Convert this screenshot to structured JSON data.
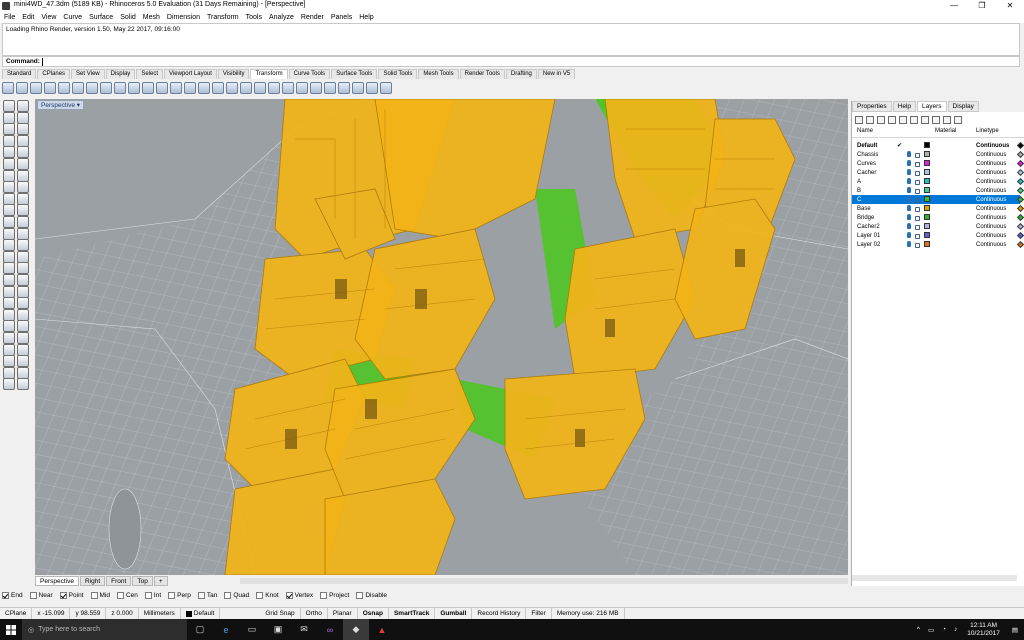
{
  "window": {
    "title": "mini4WD_47.3dm (5189 KB) - Rhinoceros 5.0 Evaluation (31 Days Remaining) - [Perspective]",
    "minimize": "—",
    "restore": "❐",
    "close": "✕"
  },
  "menu": [
    "File",
    "Edit",
    "View",
    "Curve",
    "Surface",
    "Solid",
    "Mesh",
    "Dimension",
    "Transform",
    "Tools",
    "Analyze",
    "Render",
    "Panels",
    "Help"
  ],
  "command_history": "Loading Rhino Render, version 1.50, May 22 2017, 09:16:00",
  "command_prompt": "Command:",
  "toolbar_tabs": [
    "Standard",
    "CPlanes",
    "Set View",
    "Display",
    "Select",
    "Viewport Layout",
    "Visibility",
    "Transform",
    "Curve Tools",
    "Surface Tools",
    "Solid Tools",
    "Mesh Tools",
    "Render Tools",
    "Drafting",
    "New in V5"
  ],
  "active_toolbar_tab": "Transform",
  "viewport": {
    "label": "Perspective",
    "dropdown": "▾"
  },
  "view_tabs": [
    "Perspective",
    "Right",
    "Front",
    "Top"
  ],
  "view_tab_add": "+",
  "osnaps": [
    {
      "label": "End",
      "on": true
    },
    {
      "label": "Near",
      "on": false
    },
    {
      "label": "Point",
      "on": true
    },
    {
      "label": "Mid",
      "on": false
    },
    {
      "label": "Cen",
      "on": false
    },
    {
      "label": "Int",
      "on": false
    },
    {
      "label": "Perp",
      "on": false
    },
    {
      "label": "Tan",
      "on": false
    },
    {
      "label": "Quad",
      "on": false
    },
    {
      "label": "Knot",
      "on": false
    },
    {
      "label": "Vertex",
      "on": true
    },
    {
      "label": "Project",
      "on": false
    },
    {
      "label": "Disable",
      "on": false
    }
  ],
  "status": {
    "cplane": "CPlane",
    "x": "x -15.099",
    "y": "y 98.559",
    "z": "z 0.000",
    "units": "Millimeters",
    "layer": "Default",
    "grid_snap": "Grid Snap",
    "ortho": "Ortho",
    "planar": "Planar",
    "osnap": "Osnap",
    "smarttrack": "SmartTrack",
    "gumball": "Gumball",
    "record_history": "Record History",
    "filter": "Filter",
    "memory": "Memory use: 216 MB"
  },
  "panel": {
    "tabs": [
      "Properties",
      "Help",
      "Layers",
      "Display"
    ],
    "active_tab": "Layers",
    "columns": {
      "name": "Name",
      "material": "Material",
      "linetype": "Linetype"
    },
    "layers": [
      {
        "name": "Default",
        "linetype": "Continuous",
        "color": "#000000",
        "current": true,
        "bold": true
      },
      {
        "name": "Chassis",
        "linetype": "Continuous",
        "color": "#b0b0b0"
      },
      {
        "name": "Curves",
        "linetype": "Continuous",
        "color": "#e020e0"
      },
      {
        "name": "Cacher",
        "linetype": "Continuous",
        "color": "#a8c8e0"
      },
      {
        "name": "A",
        "linetype": "Continuous",
        "color": "#20c0c0"
      },
      {
        "name": "B",
        "linetype": "Continuous",
        "color": "#40d090"
      },
      {
        "name": "C",
        "linetype": "Continuous",
        "color": "#30c030",
        "selected": true
      },
      {
        "name": "Base",
        "linetype": "Continuous",
        "color": "#e0a000"
      },
      {
        "name": "Bridge",
        "linetype": "Continuous",
        "color": "#30b030"
      },
      {
        "name": "Cacher2",
        "linetype": "Continuous",
        "color": "#b0b0e0"
      },
      {
        "name": "Layer 01",
        "linetype": "Continuous",
        "color": "#6060d0"
      },
      {
        "name": "Layer 02",
        "linetype": "Continuous",
        "color": "#e07020"
      }
    ],
    "current_mark": "✔"
  },
  "taskbar": {
    "search_placeholder": "Type here to search",
    "time": "12:11 AM",
    "date": "10/21/2017"
  },
  "colors": {
    "model_fill": "#f2b418",
    "model_edge": "#b07800",
    "green": "#4ac81e",
    "viewport_bg": "#9aa0a4",
    "accent": "#0078d7"
  }
}
